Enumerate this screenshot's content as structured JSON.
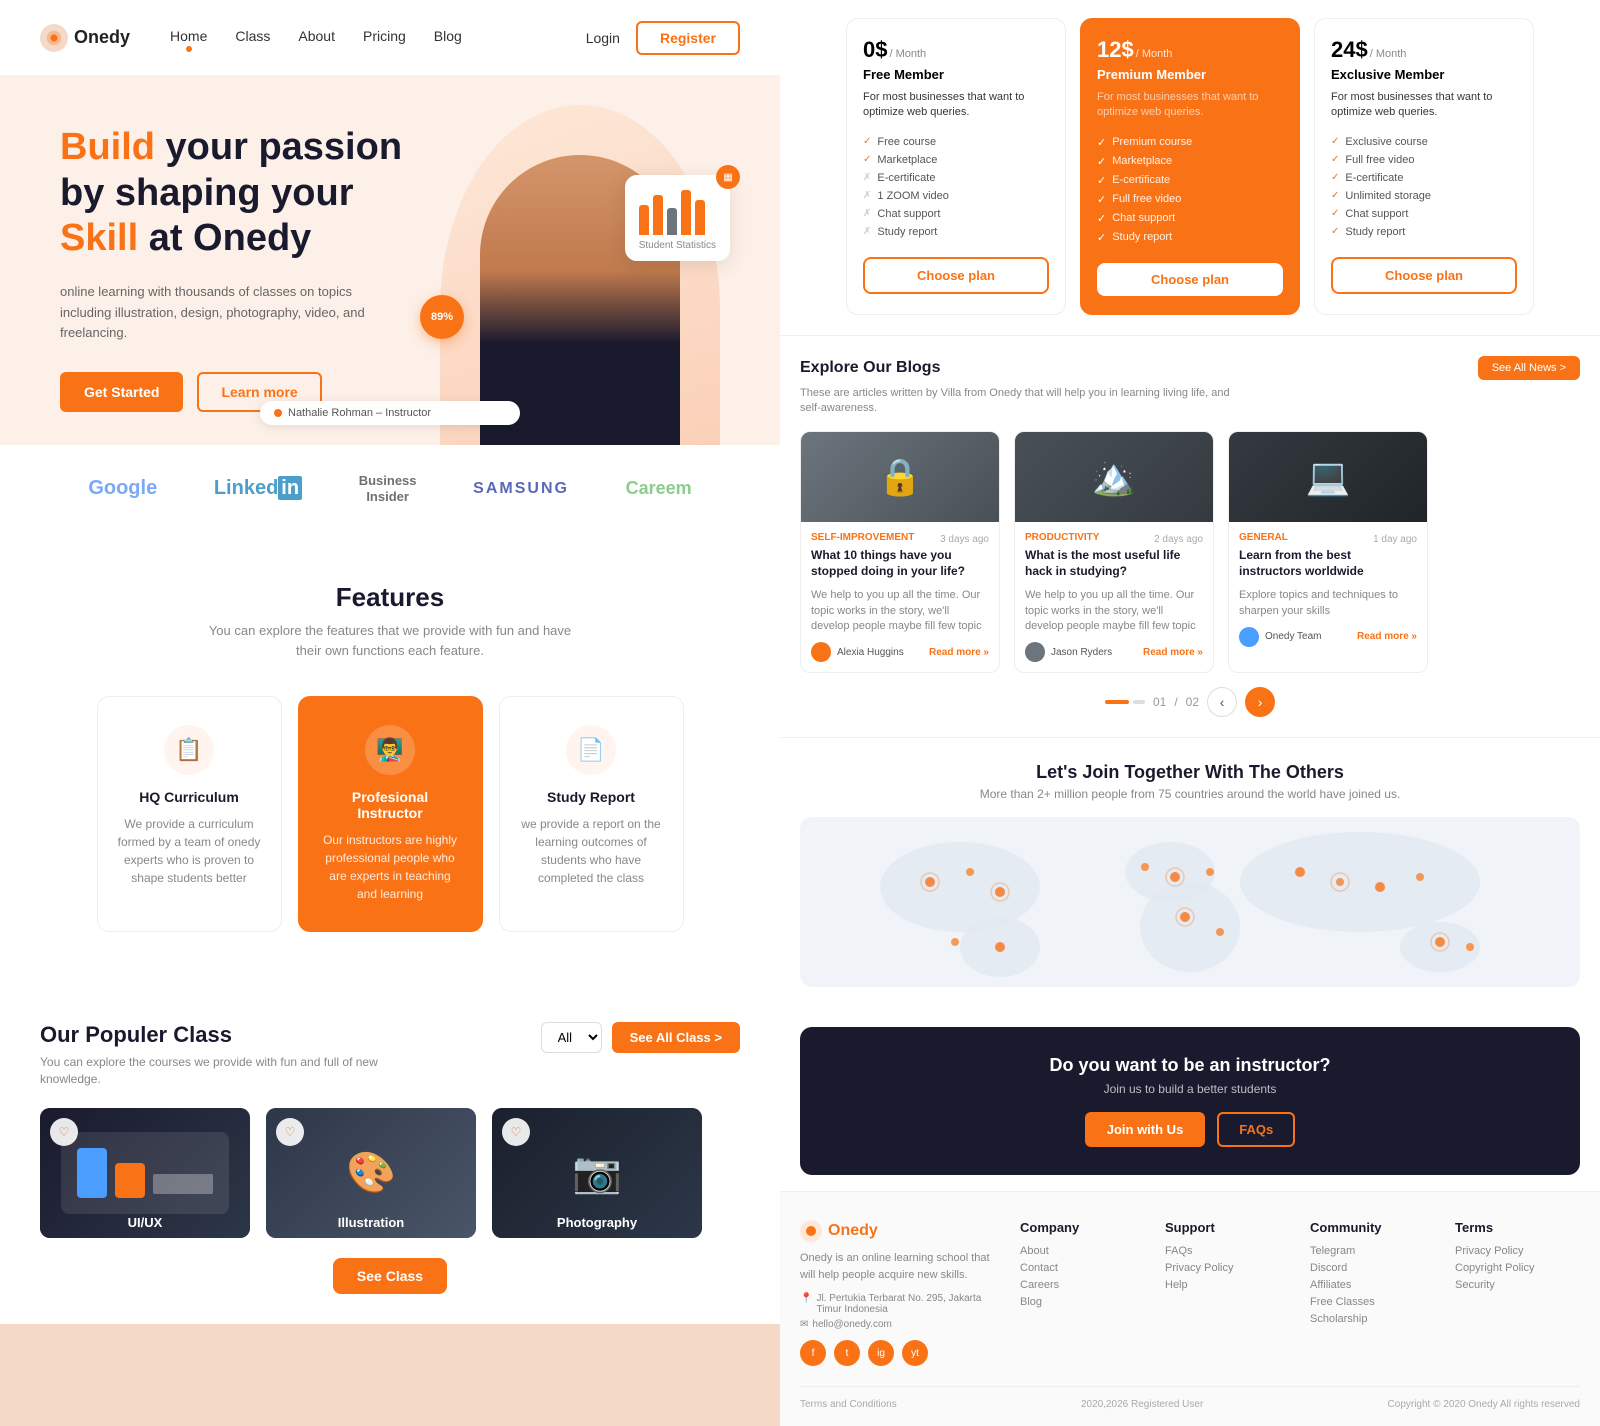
{
  "nav": {
    "logo_text": "Onedy",
    "links": [
      {
        "label": "Home",
        "active": true
      },
      {
        "label": "Class",
        "active": false
      },
      {
        "label": "About",
        "active": false
      },
      {
        "label": "Pricing",
        "active": false
      },
      {
        "label": "Blog",
        "active": false
      }
    ],
    "login_label": "Login",
    "register_label": "Register"
  },
  "hero": {
    "title_part1": "Build",
    "title_part2": " your passion by shaping your ",
    "title_part3": "Skill",
    "title_part4": " at Onedy",
    "desc": "online learning with thousands of classes on topics including illustration, design, photography, video, and freelancing.",
    "get_started": "Get Started",
    "learn_more": "Learn more",
    "progress_badge": "89%",
    "stats_card_label": "Student Statistics",
    "instructor_name": "Nathalie Rohman – Instructor"
  },
  "partners": [
    {
      "label": "Google"
    },
    {
      "label": "LinkedIn"
    },
    {
      "label": "Business\nInsider"
    },
    {
      "label": "SAMSUNG"
    },
    {
      "label": "Careem"
    }
  ],
  "features": {
    "title": "Features",
    "desc": "You can explore the features that we provide with fun and have their own functions each feature.",
    "items": [
      {
        "name": "HQ Curriculum",
        "desc": "We provide a curriculum formed by a team of onedy experts who is proven to shape students better",
        "active": false
      },
      {
        "name": "Profesional Instructor",
        "desc": "Our instructors are highly professional people who are experts in teaching and learning",
        "active": true
      },
      {
        "name": "Study Report",
        "desc": "we provide a report on the learning outcomes of students who have completed the class",
        "active": false
      }
    ]
  },
  "popular_classes": {
    "title": "Our Populer Class",
    "desc": "You can explore the courses we provide with fun and full of new knowledge.",
    "filter_label": "All",
    "see_all": "See All Class >",
    "see_class_btn": "See Class",
    "classes": [
      {
        "label": "UI/UX"
      },
      {
        "label": "Illustration"
      },
      {
        "label": "Photography"
      }
    ]
  },
  "pricing": {
    "plans": [
      {
        "price": "0$",
        "period": "/ Month",
        "name": "Free Member",
        "desc": "For most businesses that want to optimize web queries.",
        "features": [
          {
            "label": "Free course",
            "included": true
          },
          {
            "label": "Marketplace",
            "included": true
          },
          {
            "label": "E-certificate",
            "included": false
          },
          {
            "label": "1 ZOOM video",
            "included": false
          },
          {
            "label": "Chat support",
            "included": false
          },
          {
            "label": "Study report",
            "included": false
          }
        ],
        "btn_label": "Choose plan",
        "featured": false
      },
      {
        "price": "12$",
        "period": "/ Month",
        "name": "Premium Member",
        "desc": "For most businesses that want to optimize web queries.",
        "features": [
          {
            "label": "Premium course",
            "included": true
          },
          {
            "label": "Marketplace",
            "included": true
          },
          {
            "label": "E-certificate",
            "included": true
          },
          {
            "label": "Full free video",
            "included": true
          },
          {
            "label": "Chat support",
            "included": true
          },
          {
            "label": "Study report",
            "included": true
          }
        ],
        "btn_label": "Choose plan",
        "featured": true
      },
      {
        "price": "24$",
        "period": "/ Month",
        "name": "Exclusive Member",
        "desc": "For most businesses that want to optimize web queries.",
        "features": [
          {
            "label": "Exclusive course",
            "included": true
          },
          {
            "label": "Full free video",
            "included": true
          },
          {
            "label": "E-certificate",
            "included": true
          },
          {
            "label": "Unlimited storage",
            "included": true
          },
          {
            "label": "Chat support",
            "included": true
          },
          {
            "label": "Study report",
            "included": true
          }
        ],
        "btn_label": "Choose plan",
        "featured": false
      }
    ]
  },
  "blogs": {
    "title": "Explore Our Blogs",
    "desc": "These are articles written by Villa from Onedy that will help you in learning living life, and self-awareness.",
    "see_all_label": "See All News >",
    "posts": [
      {
        "category": "Self-Improvement",
        "time": "3 days ago",
        "title": "What 10 things have you stopped doing in your life?",
        "excerpt": "We help to you up all the time. Our topic works in the story, we'll develop people maybe fill few topic",
        "author": "Alexia Huggins",
        "read_more": "Read more »"
      },
      {
        "category": "Productivity",
        "time": "2 days ago",
        "title": "What is the most useful life hack in studying?",
        "excerpt": "We help to you up all the time. Our topic works in the story, we'll develop people maybe fill few topic",
        "author": "Jason Ryders",
        "read_more": "Read more »"
      },
      {
        "category": "General",
        "time": "1 day ago",
        "title": "Learn from the best instructors worldwide",
        "excerpt": "Explore topics and techniques to sharpen your skills",
        "author": "Onedy Team",
        "read_more": "Read more »"
      }
    ],
    "page_current": "01",
    "page_total": "02"
  },
  "map": {
    "title": "Let's Join Together With The Others",
    "desc": "More than 2+ million people from 75 countries around the world have joined us."
  },
  "instructor_cta": {
    "title": "Do you want to be an instructor?",
    "desc": "Join us to build a better students",
    "join_btn": "Join with Us",
    "faq_btn": "FAQs"
  },
  "footer": {
    "logo_text": "Onedy",
    "brand_desc": "Onedy is an online learning school that will help people acquire new skills.",
    "address": "Jl. Pertukia Terbarat No. 295, Jakarta Timur Indonesia",
    "email": "hello@onedy.com",
    "columns": [
      {
        "title": "Company",
        "links": [
          "About",
          "Contact",
          "Careers",
          "Blog"
        ]
      },
      {
        "title": "Support",
        "links": [
          "FAQs",
          "Privacy Policy",
          "Help"
        ]
      },
      {
        "title": "Community",
        "links": [
          "Telegram",
          "Discord",
          "Affiliates",
          "Free Classes",
          "Scholarship"
        ]
      },
      {
        "title": "Terms",
        "links": [
          "Privacy Policy",
          "Copyright Policy",
          "Security"
        ]
      }
    ],
    "terms_label": "Terms and Conditions",
    "registered_label": "2020,2026 Registered User",
    "copyright_label": "Copyright © 2020 Onedy All rights reserved"
  }
}
